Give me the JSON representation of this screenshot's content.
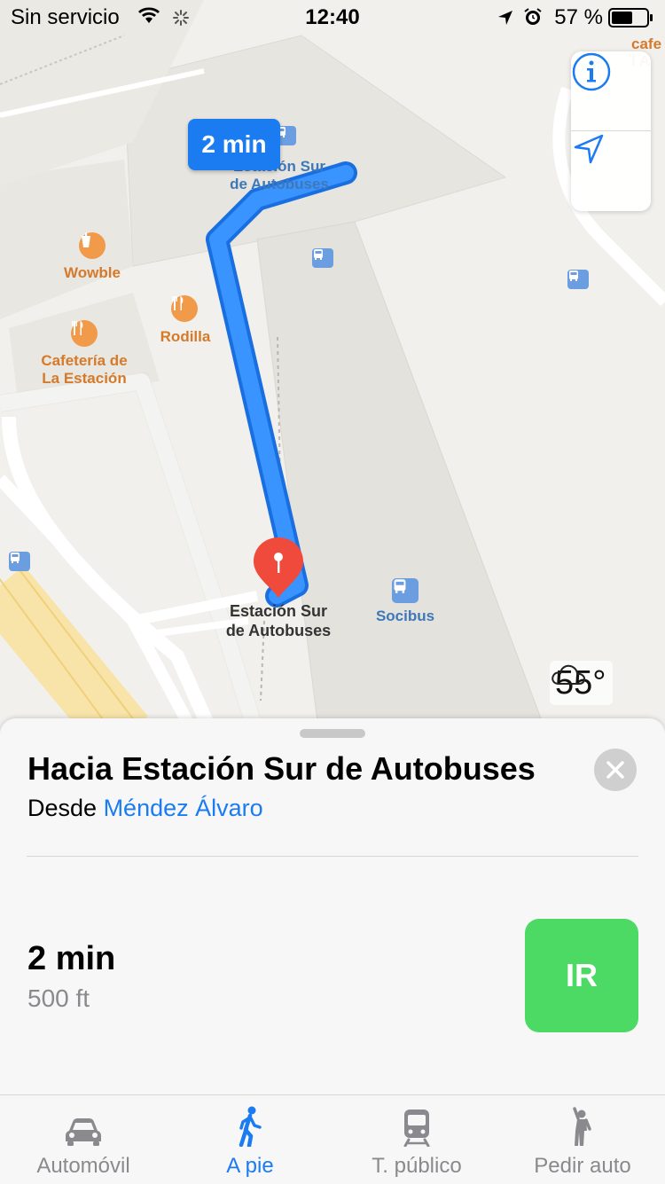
{
  "status_bar": {
    "carrier": "Sin servicio",
    "time": "12:40",
    "battery": "57 %"
  },
  "map": {
    "route_badge": "2 min",
    "labels": {
      "destination_top_line1": "Estación Sur",
      "destination_top_line2": "de Autobuses",
      "wowble": "Wowble",
      "rodilla": "Rodilla",
      "cafeteria_line1": "Cafetería de",
      "cafeteria_line2": "La Estación",
      "destination_line1": "Estación Sur",
      "destination_line2": "de Autobuses",
      "socibus": "Socibus",
      "corner_line1": "cafe",
      "corner_line2": "l A"
    },
    "weather": "55°",
    "icons": [
      "info-icon",
      "location-arrow-icon",
      "cloud-icon",
      "bus-icon",
      "cup-icon",
      "fork-knife-icon",
      "map-pin-icon"
    ]
  },
  "sheet": {
    "title": "Hacia Estación Sur de Autobuses",
    "from_label": "Desde",
    "from_place": "Méndez Álvaro",
    "eta_time": "2 min",
    "eta_distance": "500 ft",
    "go_label": "IR"
  },
  "tabs": [
    {
      "label": "Automóvil",
      "icon": "car-icon"
    },
    {
      "label": "A pie",
      "icon": "walking-icon",
      "active": true
    },
    {
      "label": "T. público",
      "icon": "train-icon"
    },
    {
      "label": "Pedir auto",
      "icon": "hail-icon"
    }
  ],
  "colors": {
    "accent": "#1a7cf0",
    "route": "#2f8bff",
    "go_button": "#4cd964",
    "pin": "#f04a3c",
    "poi": "#d57a2a"
  }
}
